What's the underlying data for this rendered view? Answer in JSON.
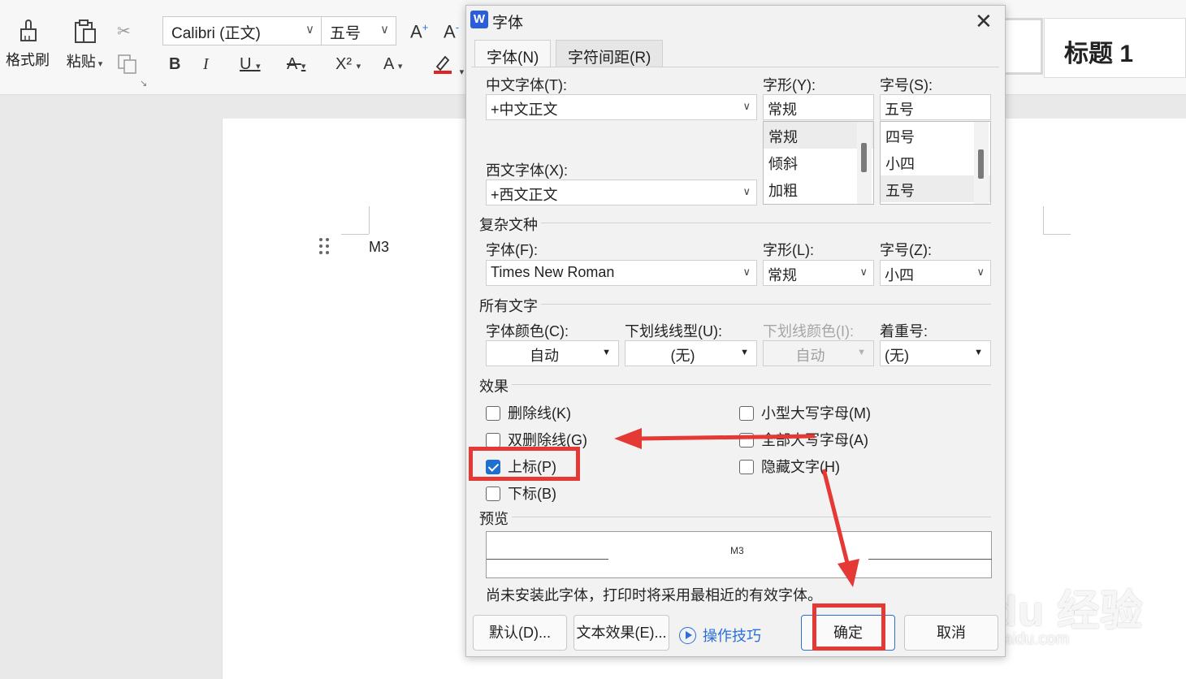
{
  "ribbon": {
    "format_painter_label": "格式刷",
    "paste_label": "粘贴",
    "font_name": "Calibri (正文)",
    "font_size": "五号",
    "bold": "B",
    "italic": "I",
    "underline": "U",
    "strike": "A",
    "superscript": "X²",
    "font_color_glyph": "A",
    "grow_font": "A+",
    "shrink_font": "A-",
    "style_heading": "标题 1"
  },
  "document": {
    "text": "M3"
  },
  "dialog": {
    "title": "字体",
    "tabs": [
      "字体(N)",
      "字符间距(R)"
    ],
    "chinese_font_label": "中文字体(T):",
    "chinese_font_value": "+中文正文",
    "western_font_label": "西文字体(X):",
    "western_font_value": "+西文正文",
    "style_label": "字形(Y):",
    "style_value": "常规",
    "style_options": [
      "常规",
      "倾斜",
      "加粗"
    ],
    "size_label": "字号(S):",
    "size_value": "五号",
    "size_options": [
      "四号",
      "小四",
      "五号"
    ],
    "complex_section": "复杂文种",
    "complex_font_label": "字体(F):",
    "complex_font_value": "Times New Roman",
    "complex_style_label": "字形(L):",
    "complex_style_value": "常规",
    "complex_size_label": "字号(Z):",
    "complex_size_value": "小四",
    "all_text_section": "所有文字",
    "font_color_label": "字体颜色(C):",
    "font_color_value": "自动",
    "underline_type_label": "下划线线型(U):",
    "underline_type_value": "(无)",
    "underline_color_label": "下划线颜色(I):",
    "underline_color_value": "自动",
    "emphasis_label": "着重号:",
    "emphasis_value": "(无)",
    "effects_section": "效果",
    "effects": {
      "strikethrough": {
        "label": "删除线(K)",
        "checked": false
      },
      "double_strikethrough": {
        "label": "双删除线(G)",
        "checked": false
      },
      "superscript": {
        "label": "上标(P)",
        "checked": true
      },
      "subscript": {
        "label": "下标(B)",
        "checked": false
      },
      "small_caps": {
        "label": "小型大写字母(M)",
        "checked": false
      },
      "all_caps": {
        "label": "全部大写字母(A)",
        "checked": false
      },
      "hidden": {
        "label": "隐藏文字(H)",
        "checked": false
      }
    },
    "preview_section": "预览",
    "preview_text": "M3",
    "note": "尚未安装此字体，打印时将采用最相近的有效字体。",
    "btn_default": "默认(D)...",
    "btn_text_effects": "文本效果(E)...",
    "tips_link": "操作技巧",
    "btn_ok": "确定",
    "btn_cancel": "取消"
  },
  "watermark": {
    "brand": "Bai du 经验",
    "url": "jingyan.baidu.com"
  },
  "colors": {
    "annotation_red": "#e53935",
    "accent_blue": "#2a6fd6"
  }
}
